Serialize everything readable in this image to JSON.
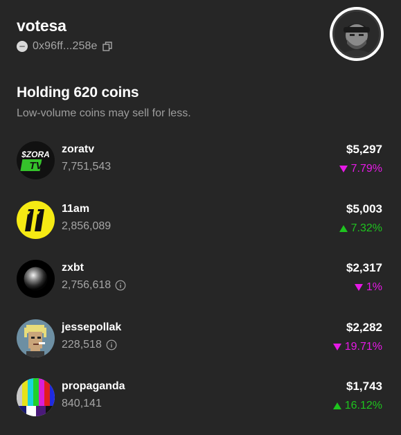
{
  "profile": {
    "username": "votesa",
    "address": "0x96ff...258e",
    "avatar_icon": "person-beanie-avatar",
    "copy_icon": "copy-icon"
  },
  "holdings": {
    "title": "Holding 620 coins",
    "subtitle": "Low-volume coins may sell for less."
  },
  "colors": {
    "background": "#262626",
    "negative": "#e619e6",
    "positive": "#1ec41e",
    "muted": "#a6a6a6"
  },
  "coins": [
    {
      "name": "zoratv",
      "amount": "7,751,543",
      "value": "$5,297",
      "change": "7.79%",
      "direction": "down",
      "has_info": false,
      "logo_text_1": "$ZORA",
      "logo_text_2": "TV"
    },
    {
      "name": "11am",
      "amount": "2,856,089",
      "value": "$5,003",
      "change": "7.32%",
      "direction": "up",
      "has_info": false
    },
    {
      "name": "zxbt",
      "amount": "2,756,618",
      "value": "$2,317",
      "change": "1%",
      "direction": "down",
      "has_info": true
    },
    {
      "name": "jessepollak",
      "amount": "228,518",
      "value": "$2,282",
      "change": "19.71%",
      "direction": "down",
      "has_info": true
    },
    {
      "name": "propaganda",
      "amount": "840,141",
      "value": "$1,743",
      "change": "16.12%",
      "direction": "up",
      "has_info": false
    }
  ]
}
